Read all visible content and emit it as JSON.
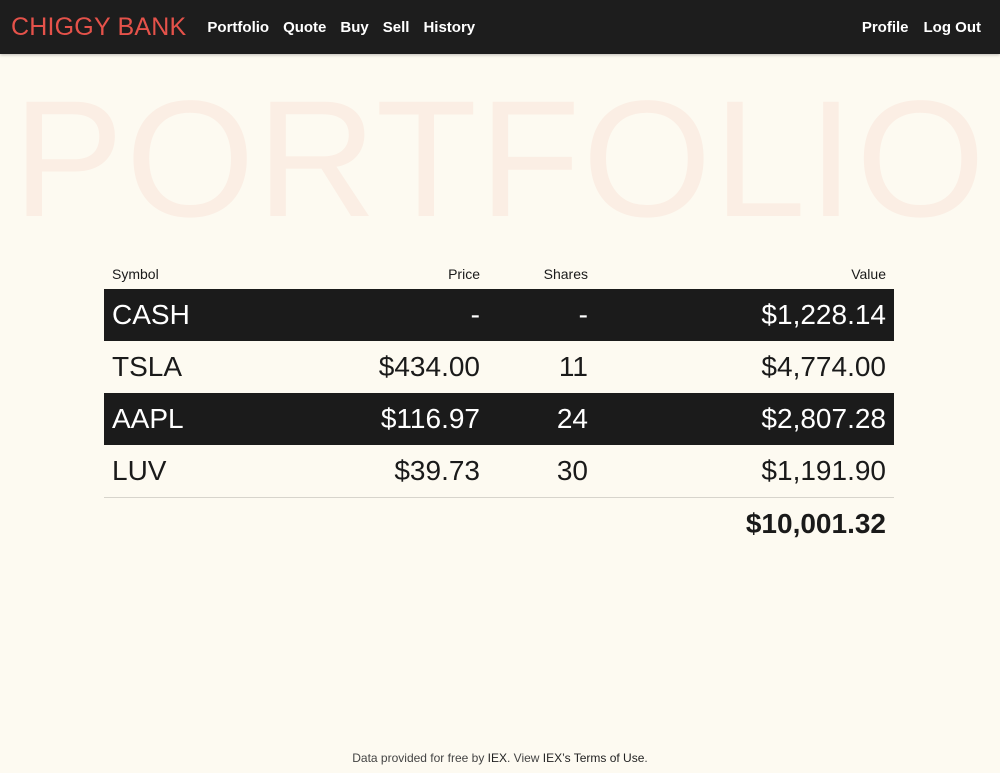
{
  "nav": {
    "brand": "CHIGGY BANK",
    "links": [
      "Portfolio",
      "Quote",
      "Buy",
      "Sell",
      "History"
    ],
    "right": [
      "Profile",
      "Log Out"
    ]
  },
  "hero": "PORTFOLIO",
  "table": {
    "headers": {
      "symbol": "Symbol",
      "price": "Price",
      "shares": "Shares",
      "value": "Value"
    },
    "rows": [
      {
        "symbol": "CASH",
        "price": "-",
        "shares": "-",
        "value": "$1,228.14"
      },
      {
        "symbol": "TSLA",
        "price": "$434.00",
        "shares": "11",
        "value": "$4,774.00"
      },
      {
        "symbol": "AAPL",
        "price": "$116.97",
        "shares": "24",
        "value": "$2,807.28"
      },
      {
        "symbol": "LUV",
        "price": "$39.73",
        "shares": "30",
        "value": "$1,191.90"
      }
    ],
    "total": "$10,001.32"
  },
  "footer": {
    "prefix": "Data provided for free by ",
    "iex_link": "IEX",
    "middle": ". View ",
    "terms_link": "IEX’s Terms of Use",
    "suffix": "."
  },
  "colors": {
    "brand": "#e5524a",
    "navbar": "#1d1d1d",
    "background": "#fdfaf1",
    "hero": "#fbeee4"
  }
}
